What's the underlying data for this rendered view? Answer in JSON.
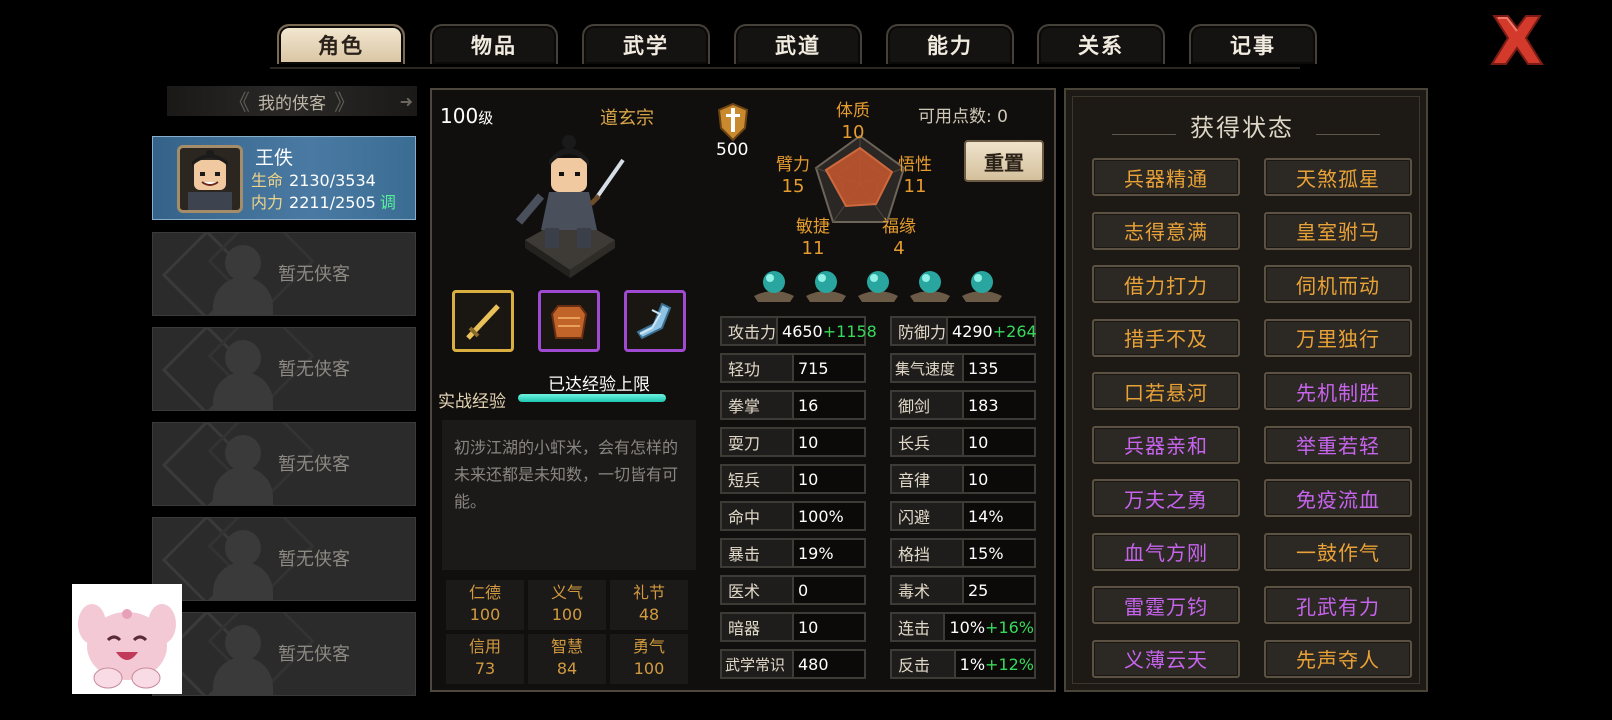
{
  "tabs": [
    {
      "label": "角色",
      "active": true
    },
    {
      "label": "物品",
      "active": false
    },
    {
      "label": "武学",
      "active": false
    },
    {
      "label": "武道",
      "active": false
    },
    {
      "label": "能力",
      "active": false
    },
    {
      "label": "关系",
      "active": false
    },
    {
      "label": "记事",
      "active": false
    }
  ],
  "roster": {
    "header": "我的侠客",
    "hero": {
      "name": "王佚",
      "hp_label": "生命",
      "hp_value": "2130/3534",
      "mp_label": "内力",
      "mp_value": "2211/2505",
      "adjust_label": "调"
    },
    "empty_label": "暂无侠客"
  },
  "character": {
    "level": "100",
    "level_unit": "级",
    "sect": "道玄宗",
    "badge_value": "500",
    "available_points_label": "可用点数",
    "available_points_sep": ":",
    "available_points": "0",
    "reset_label": "重置",
    "attributes": {
      "constitution": {
        "label": "体质",
        "value": "10"
      },
      "arm": {
        "label": "臂力",
        "value": "15"
      },
      "insight": {
        "label": "悟性",
        "value": "11"
      },
      "agility": {
        "label": "敏捷",
        "value": "11"
      },
      "fortune": {
        "label": "福缘",
        "value": "4"
      }
    },
    "xp_label": "实战经验",
    "xp_cap_text": "已达经验上限",
    "xp_fill": 1.0,
    "description": "初涉江湖的小虾米，会有怎样的未来还都是未知数，一切皆有可能。",
    "virtues": [
      {
        "name": "仁德",
        "value": "100"
      },
      {
        "name": "义气",
        "value": "100"
      },
      {
        "name": "礼节",
        "value": "48"
      },
      {
        "name": "信用",
        "value": "73"
      },
      {
        "name": "智慧",
        "value": "84"
      },
      {
        "name": "勇气",
        "value": "100"
      }
    ],
    "stats_left": [
      {
        "key": "攻击力",
        "value": "4650",
        "bonus": "+1158"
      },
      {
        "key": "轻功",
        "value": "715",
        "bonus": ""
      },
      {
        "key": "拳掌",
        "value": "16",
        "bonus": ""
      },
      {
        "key": "耍刀",
        "value": "10",
        "bonus": ""
      },
      {
        "key": "短兵",
        "value": "10",
        "bonus": ""
      },
      {
        "key": "命中",
        "value": "100%",
        "bonus": ""
      },
      {
        "key": "暴击",
        "value": "19%",
        "bonus": ""
      },
      {
        "key": "医术",
        "value": "0",
        "bonus": ""
      },
      {
        "key": "暗器",
        "value": "10",
        "bonus": ""
      },
      {
        "key": "武学常识",
        "value": "480",
        "bonus": ""
      }
    ],
    "stats_right": [
      {
        "key": "防御力",
        "value": "4290",
        "bonus": "+264"
      },
      {
        "key": "集气速度",
        "value": "135",
        "bonus": ""
      },
      {
        "key": "御剑",
        "value": "183",
        "bonus": ""
      },
      {
        "key": "长兵",
        "value": "10",
        "bonus": ""
      },
      {
        "key": "音律",
        "value": "10",
        "bonus": ""
      },
      {
        "key": "闪避",
        "value": "14%",
        "bonus": ""
      },
      {
        "key": "格挡",
        "value": "15%",
        "bonus": ""
      },
      {
        "key": "毒术",
        "value": "25",
        "bonus": ""
      },
      {
        "key": "连击",
        "value": "10%",
        "bonus": "+16%"
      },
      {
        "key": "反击",
        "value": "1%",
        "bonus": "+12%"
      }
    ]
  },
  "status_panel": {
    "title": "获得状态",
    "items": [
      {
        "label": "兵器精通",
        "color": "gold"
      },
      {
        "label": "天煞孤星",
        "color": "gold"
      },
      {
        "label": "志得意满",
        "color": "gold"
      },
      {
        "label": "皇室驸马",
        "color": "gold"
      },
      {
        "label": "借力打力",
        "color": "gold"
      },
      {
        "label": "伺机而动",
        "color": "gold"
      },
      {
        "label": "措手不及",
        "color": "gold"
      },
      {
        "label": "万里独行",
        "color": "gold"
      },
      {
        "label": "口若悬河",
        "color": "gold"
      },
      {
        "label": "先机制胜",
        "color": "purple"
      },
      {
        "label": "兵器亲和",
        "color": "purple"
      },
      {
        "label": "举重若轻",
        "color": "purple"
      },
      {
        "label": "万夫之勇",
        "color": "purple"
      },
      {
        "label": "免疫流血",
        "color": "purple"
      },
      {
        "label": "血气方刚",
        "color": "purple"
      },
      {
        "label": "一鼓作气",
        "color": "gold"
      },
      {
        "label": "雷霆万钧",
        "color": "purple"
      },
      {
        "label": "孔武有力",
        "color": "purple"
      },
      {
        "label": "义薄云天",
        "color": "purple"
      },
      {
        "label": "先声夺人",
        "color": "gold"
      }
    ]
  },
  "colors": {
    "accent_gold": "#e9a237",
    "accent_purple": "#c764ee",
    "bonus_green": "#38d95a",
    "active_slot_blue": "#4a7aa3",
    "close_red": "#d33a2c"
  }
}
